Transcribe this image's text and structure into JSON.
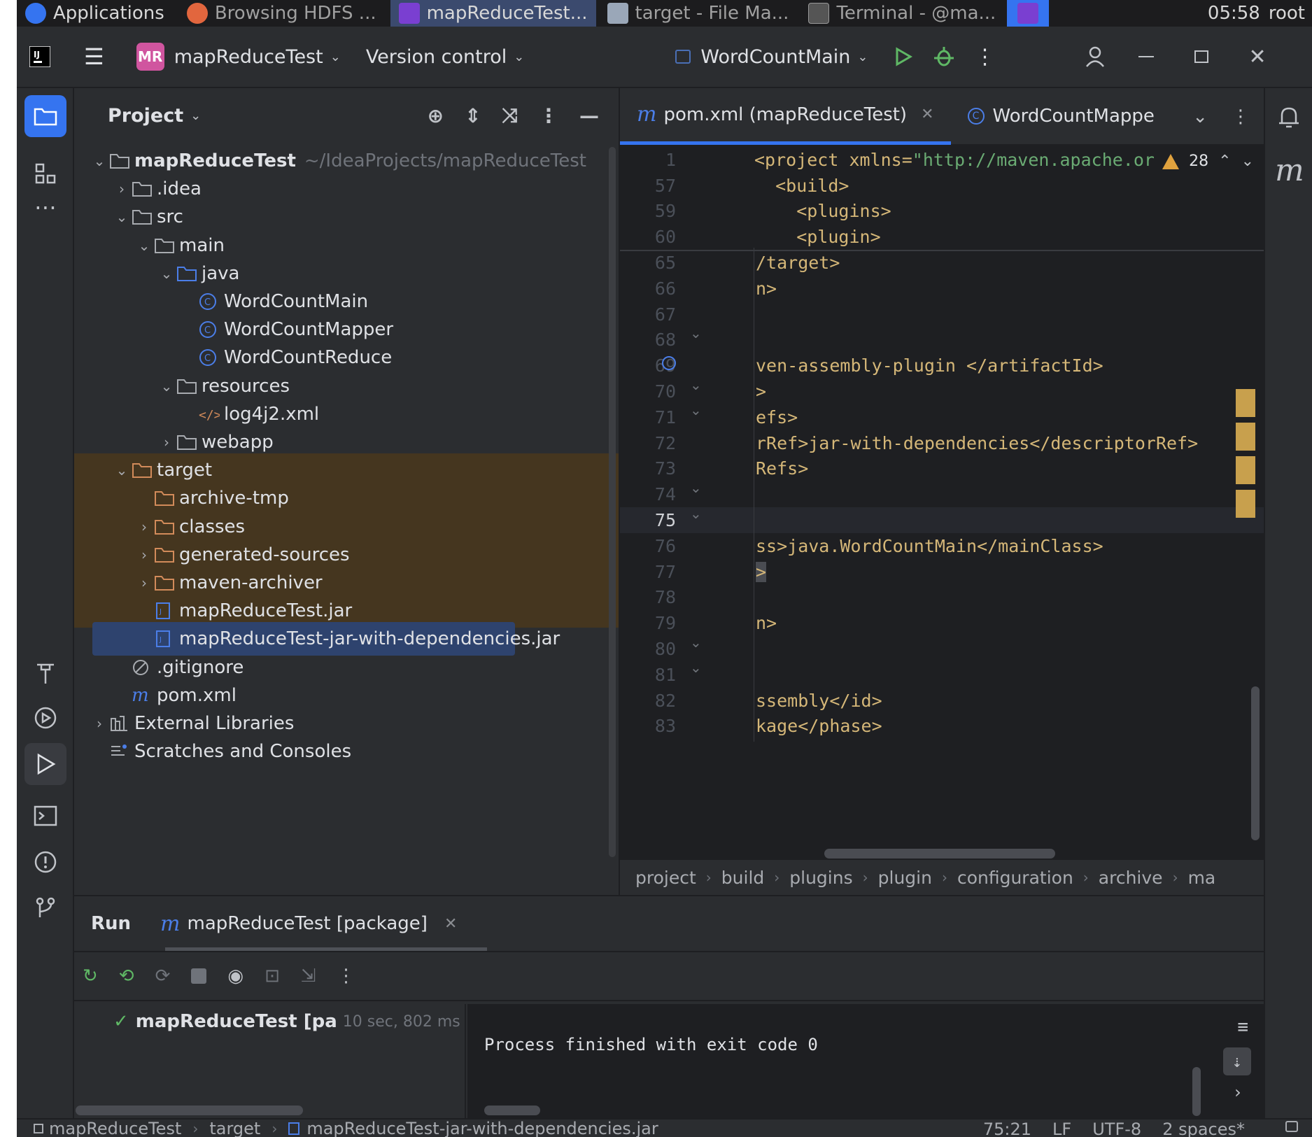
{
  "taskbar": {
    "items": [
      {
        "label": "Applications",
        "color": "#3574f0"
      },
      {
        "label": "Browsing HDFS ...",
        "color": "#e2663e"
      },
      {
        "label": "mapReduceTest...",
        "color": "#7a3fd1"
      },
      {
        "label": "target - File Ma...",
        "color": "#9aa7b8"
      },
      {
        "label": "Terminal - @ma...",
        "color": "#555"
      }
    ],
    "clock": "05:58",
    "user": "root"
  },
  "toolbar": {
    "project_badge": "MR",
    "project_name": "mapReduceTest",
    "version_control": "Version control",
    "run_config": "WordCountMain"
  },
  "project_panel": {
    "title": "Project",
    "tree": [
      {
        "label": "mapReduceTest",
        "hint": "~/IdeaProjects/mapReduceTest",
        "depth": 0,
        "arrow": "down",
        "icon": "module-folder-icon"
      },
      {
        "label": ".idea",
        "depth": 1,
        "arrow": "right",
        "icon": "folder-icon"
      },
      {
        "label": "src",
        "depth": 1,
        "arrow": "down",
        "icon": "folder-icon"
      },
      {
        "label": "main",
        "depth": 2,
        "arrow": "down",
        "icon": "folder-icon"
      },
      {
        "label": "java",
        "depth": 3,
        "arrow": "down",
        "icon": "source-folder-icon"
      },
      {
        "label": "WordCountMain",
        "depth": 4,
        "arrow": "",
        "icon": "java-class-main-icon"
      },
      {
        "label": "WordCountMapper",
        "depth": 4,
        "arrow": "",
        "icon": "java-class-icon"
      },
      {
        "label": "WordCountReduce",
        "depth": 4,
        "arrow": "",
        "icon": "java-class-icon"
      },
      {
        "label": "resources",
        "depth": 3,
        "arrow": "down",
        "icon": "resources-folder-icon"
      },
      {
        "label": "log4j2.xml",
        "depth": 4,
        "arrow": "",
        "icon": "xml-file-icon"
      },
      {
        "label": "webapp",
        "depth": 3,
        "arrow": "right",
        "icon": "folder-icon"
      },
      {
        "label": "target",
        "depth": 1,
        "arrow": "down",
        "icon": "excluded-folder-icon",
        "excluded": true
      },
      {
        "label": "archive-tmp",
        "depth": 2,
        "arrow": "",
        "icon": "excluded-folder-icon",
        "excluded": true
      },
      {
        "label": "classes",
        "depth": 2,
        "arrow": "right",
        "icon": "excluded-folder-icon",
        "excluded": true
      },
      {
        "label": "generated-sources",
        "depth": 2,
        "arrow": "right",
        "icon": "excluded-folder-icon",
        "excluded": true
      },
      {
        "label": "maven-archiver",
        "depth": 2,
        "arrow": "right",
        "icon": "excluded-folder-icon",
        "excluded": true
      },
      {
        "label": "mapReduceTest.jar",
        "depth": 2,
        "arrow": "",
        "icon": "jar-file-icon",
        "excluded": true
      },
      {
        "label": "mapReduceTest-jar-with-dependencies.jar",
        "depth": 2,
        "arrow": "",
        "icon": "jar-file-icon",
        "selected": true
      },
      {
        "label": ".gitignore",
        "depth": 1,
        "arrow": "",
        "icon": "gitignore-icon"
      },
      {
        "label": "pom.xml",
        "depth": 1,
        "arrow": "",
        "icon": "maven-icon"
      },
      {
        "label": "External Libraries",
        "depth": 0,
        "arrow": "right",
        "icon": "library-icon"
      },
      {
        "label": "Scratches and Consoles",
        "depth": 0,
        "arrow": "",
        "icon": "scratches-icon"
      }
    ]
  },
  "editor": {
    "tabs": [
      {
        "label": "pom.xml (mapReduceTest)",
        "icon": "maven-icon",
        "active": true
      },
      {
        "label": "WordCountMapper.j",
        "icon": "java-class-icon",
        "active": false
      }
    ],
    "warning_count": "28",
    "lines": [
      {
        "n": "1",
        "text": "<project xmlns=\"http://maven.apache.or",
        "sticky": true
      },
      {
        "n": "57",
        "text": "  <build>",
        "sticky": true
      },
      {
        "n": "59",
        "text": "    <plugins>",
        "sticky": true
      },
      {
        "n": "60",
        "text": "    <plugin>",
        "sticky": true
      },
      {
        "n": "65",
        "text": "/target>"
      },
      {
        "n": "66",
        "text": "n>"
      },
      {
        "n": "67",
        "text": ""
      },
      {
        "n": "68",
        "text": "",
        "fold": true
      },
      {
        "n": "69",
        "text": "ven-assembly-plugin </artifactId>",
        "override": true
      },
      {
        "n": "70",
        "text": ">",
        "fold": true
      },
      {
        "n": "71",
        "text": "efs>",
        "fold": true
      },
      {
        "n": "72",
        "text": "rRef>jar-with-dependencies</descriptorRef>"
      },
      {
        "n": "73",
        "text": "Refs>"
      },
      {
        "n": "74",
        "text": "",
        "fold": true
      },
      {
        "n": "75",
        "text": "",
        "fold": true,
        "current": true
      },
      {
        "n": "76",
        "text": "ss>java.WordCountMain</mainClass>"
      },
      {
        "n": "77",
        "text": ">"
      },
      {
        "n": "78",
        "text": ""
      },
      {
        "n": "79",
        "text": "n>"
      },
      {
        "n": "80",
        "text": "",
        "fold": true
      },
      {
        "n": "81",
        "text": "",
        "fold": true
      },
      {
        "n": "82",
        "text": "ssembly</id>"
      },
      {
        "n": "83",
        "text": "kage</phase>"
      }
    ],
    "breadcrumbs": [
      "project",
      "build",
      "plugins",
      "plugin",
      "configuration",
      "archive",
      "ma"
    ]
  },
  "run": {
    "title": "Run",
    "tab_label": "mapReduceTest [package]",
    "tree_item": "mapReduceTest [pa",
    "tree_time": "10 sec, 802 ms",
    "console_output": "Process finished with exit code 0"
  },
  "statusbar": {
    "path": [
      "mapReduceTest",
      "target",
      "mapReduceTest-jar-with-dependencies.jar"
    ],
    "position": "75:21",
    "line_sep": "LF",
    "encoding": "UTF-8",
    "indent": "2 spaces*"
  },
  "colors": {
    "accent": "#3574f0",
    "excluded_bg": "#45361f",
    "warning": "#e0a23e",
    "xml_tag": "#d5b778",
    "xml_string": "#6aab73"
  }
}
